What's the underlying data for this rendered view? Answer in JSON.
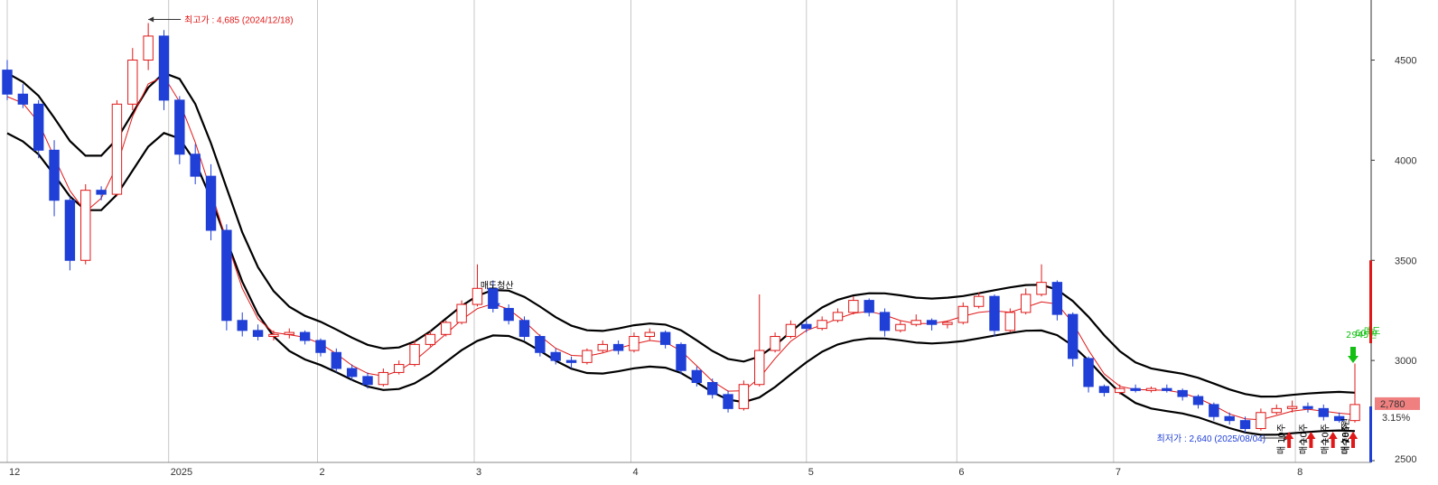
{
  "colors": {
    "up": "#e01818",
    "down": "#1f3fd6",
    "band": "#000000",
    "ma": "#e01818",
    "grid": "#c8c8c8",
    "buy": "#e01818",
    "sell": "#12c012",
    "last_badge": "#f08080",
    "scale_up": "#e01818",
    "scale_down": "#1f3fd6"
  },
  "chart_data": {
    "type": "candlestick",
    "ylim": [
      2500,
      4800
    ],
    "xlim": [
      0,
      87
    ],
    "y_ticks": [
      2500,
      3000,
      3500,
      4000,
      4500
    ],
    "x_ticks": [
      {
        "label": "12",
        "i": 0
      },
      {
        "label": "2025",
        "i": 10.3
      },
      {
        "label": "2",
        "i": 19.8
      },
      {
        "label": "3",
        "i": 29.8
      },
      {
        "label": "4",
        "i": 39.8
      },
      {
        "label": "5",
        "i": 51
      },
      {
        "label": "6",
        "i": 60.6
      },
      {
        "label": "7",
        "i": 70.6
      },
      {
        "label": "8",
        "i": 82.2
      }
    ],
    "candles": [
      [
        4450,
        4500,
        4300,
        4330
      ],
      [
        4330,
        4380,
        4260,
        4280
      ],
      [
        4280,
        4300,
        4010,
        4050
      ],
      [
        4050,
        4100,
        3720,
        3800
      ],
      [
        3800,
        3820,
        3450,
        3500
      ],
      [
        3500,
        3880,
        3480,
        3850
      ],
      [
        3850,
        3870,
        3800,
        3830
      ],
      [
        3830,
        4300,
        3820,
        4280
      ],
      [
        4280,
        4560,
        4250,
        4500
      ],
      [
        4500,
        4685,
        4450,
        4620
      ],
      [
        4620,
        4650,
        4250,
        4300
      ],
      [
        4300,
        4320,
        3980,
        4030
      ],
      [
        4030,
        4080,
        3880,
        3920
      ],
      [
        3920,
        3980,
        3600,
        3650
      ],
      [
        3650,
        3680,
        3150,
        3200
      ],
      [
        3200,
        3240,
        3120,
        3150
      ],
      [
        3150,
        3180,
        3100,
        3120
      ],
      [
        3120,
        3150,
        3100,
        3130
      ],
      [
        3130,
        3160,
        3110,
        3140
      ],
      [
        3140,
        3150,
        3080,
        3100
      ],
      [
        3100,
        3110,
        3020,
        3040
      ],
      [
        3040,
        3060,
        2940,
        2960
      ],
      [
        2960,
        2980,
        2900,
        2920
      ],
      [
        2920,
        2940,
        2860,
        2880
      ],
      [
        2880,
        2960,
        2870,
        2940
      ],
      [
        2940,
        3000,
        2930,
        2980
      ],
      [
        2980,
        3100,
        2970,
        3080
      ],
      [
        3080,
        3150,
        3070,
        3130
      ],
      [
        3130,
        3200,
        3120,
        3190
      ],
      [
        3190,
        3300,
        3180,
        3280
      ],
      [
        3280,
        3480,
        3270,
        3360
      ],
      [
        3360,
        3400,
        3240,
        3260
      ],
      [
        3260,
        3280,
        3180,
        3200
      ],
      [
        3200,
        3220,
        3100,
        3120
      ],
      [
        3120,
        3130,
        3020,
        3040
      ],
      [
        3040,
        3060,
        2980,
        3000
      ],
      [
        3000,
        3020,
        2960,
        2990
      ],
      [
        2990,
        3060,
        2980,
        3050
      ],
      [
        3050,
        3100,
        3040,
        3080
      ],
      [
        3080,
        3100,
        3030,
        3050
      ],
      [
        3050,
        3140,
        3040,
        3120
      ],
      [
        3120,
        3160,
        3100,
        3140
      ],
      [
        3140,
        3150,
        3060,
        3080
      ],
      [
        3080,
        3090,
        2930,
        2950
      ],
      [
        2950,
        2970,
        2870,
        2890
      ],
      [
        2890,
        2910,
        2810,
        2830
      ],
      [
        2830,
        2850,
        2740,
        2760
      ],
      [
        2760,
        2900,
        2750,
        2880
      ],
      [
        2880,
        3330,
        2870,
        3050
      ],
      [
        3050,
        3140,
        3040,
        3120
      ],
      [
        3120,
        3200,
        3110,
        3180
      ],
      [
        3180,
        3200,
        3140,
        3160
      ],
      [
        3160,
        3220,
        3150,
        3200
      ],
      [
        3200,
        3260,
        3190,
        3240
      ],
      [
        3240,
        3320,
        3230,
        3300
      ],
      [
        3300,
        3310,
        3220,
        3240
      ],
      [
        3240,
        3260,
        3120,
        3150
      ],
      [
        3150,
        3200,
        3140,
        3180
      ],
      [
        3180,
        3230,
        3170,
        3200
      ],
      [
        3200,
        3210,
        3150,
        3180
      ],
      [
        3180,
        3200,
        3160,
        3190
      ],
      [
        3190,
        3290,
        3180,
        3270
      ],
      [
        3270,
        3340,
        3260,
        3320
      ],
      [
        3320,
        3330,
        3120,
        3150
      ],
      [
        3150,
        3260,
        3140,
        3240
      ],
      [
        3240,
        3360,
        3230,
        3330
      ],
      [
        3330,
        3480,
        3320,
        3390
      ],
      [
        3390,
        3400,
        3200,
        3230
      ],
      [
        3230,
        3240,
        2970,
        3010
      ],
      [
        3010,
        3020,
        2840,
        2870
      ],
      [
        2870,
        2880,
        2820,
        2840
      ],
      [
        2840,
        2880,
        2830,
        2860
      ],
      [
        2860,
        2880,
        2840,
        2850
      ],
      [
        2850,
        2870,
        2840,
        2860
      ],
      [
        2860,
        2880,
        2840,
        2850
      ],
      [
        2850,
        2860,
        2800,
        2820
      ],
      [
        2820,
        2830,
        2760,
        2780
      ],
      [
        2780,
        2790,
        2700,
        2720
      ],
      [
        2720,
        2740,
        2680,
        2700
      ],
      [
        2700,
        2720,
        2640,
        2660
      ],
      [
        2660,
        2760,
        2650,
        2740
      ],
      [
        2740,
        2780,
        2730,
        2760
      ],
      [
        2760,
        2800,
        2740,
        2770
      ],
      [
        2770,
        2790,
        2740,
        2760
      ],
      [
        2760,
        2780,
        2700,
        2720
      ],
      [
        2720,
        2740,
        2690,
        2700
      ],
      [
        2700,
        2985,
        2690,
        2780
      ]
    ],
    "annotations": {
      "high": {
        "i": 9,
        "price": 4685,
        "label": "최고가 : 4,685 (2024/12/18)"
      },
      "low": {
        "i": 82,
        "price": 2640,
        "label": "최저가 : 2,640 (2025/08/04)"
      },
      "mid_label": {
        "i": 31,
        "price": 3340,
        "label": "매도청산"
      }
    },
    "signals": [
      {
        "type": "buy",
        "i": 81.8,
        "lines": [
          "매",
          "10주"
        ]
      },
      {
        "type": "buy",
        "i": 83.2,
        "lines": [
          "매수",
          "10주"
        ]
      },
      {
        "type": "buy",
        "i": 84.6,
        "lines": [
          "매수",
          "10주"
        ]
      },
      {
        "type": "buy",
        "i": 86.0,
        "lines": [
          "매수",
          "785원"
        ]
      },
      {
        "type": "buy",
        "i": 88.0,
        "lines": [
          "매수",
          "10주"
        ]
      },
      {
        "type": "buy",
        "i": 90.0,
        "lines": [
          "매수",
          "10주"
        ]
      },
      {
        "type": "sell",
        "i": 90.5,
        "lines": [
          "2945원",
          "60주",
          "매도"
        ]
      }
    ],
    "last": {
      "price": "2,780",
      "change": "3.15%"
    }
  }
}
